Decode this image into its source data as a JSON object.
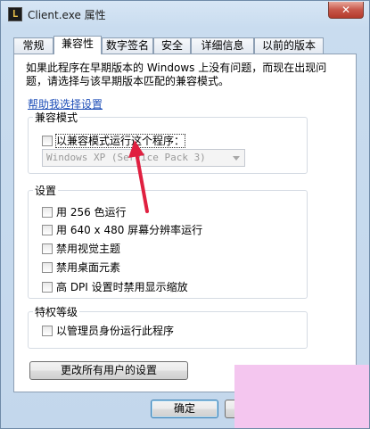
{
  "window": {
    "title": "Client.exe 属性",
    "app_icon_glyph": "L",
    "close_glyph": "✕"
  },
  "tabs": [
    "常规",
    "兼容性",
    "数字签名",
    "安全",
    "详细信息",
    "以前的版本"
  ],
  "active_tab": "兼容性",
  "description": "如果此程序在早期版本的 Windows 上没有问题，而现在出现问题，请选择与该早期版本匹配的兼容模式。",
  "help_link": "帮助我选择设置",
  "compat_mode": {
    "title": "兼容模式",
    "checkbox_label": "以兼容模式运行这个程序：",
    "select_value": "Windows XP (Service Pack 3)"
  },
  "settings": {
    "title": "设置",
    "items": [
      "用 256 色运行",
      "用 640 x 480 屏幕分辨率运行",
      "禁用视觉主题",
      "禁用桌面元素",
      "高 DPI 设置时禁用显示缩放"
    ]
  },
  "privilege": {
    "title": "特权等级",
    "checkbox_label": "以管理员身份运行此程序"
  },
  "change_all_button": "更改所有用户的设置",
  "ok_button": "确定",
  "colors": {
    "annotation_arrow": "#e02040",
    "overlay_block": "#f4c6ef",
    "link": "#1f4fb8"
  }
}
